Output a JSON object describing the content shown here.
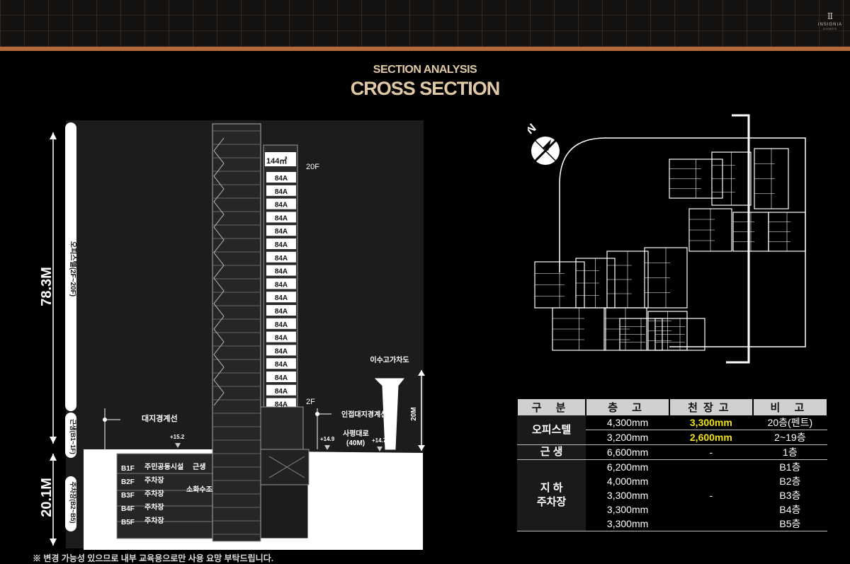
{
  "header": {
    "logo_mark": "Ⅱ",
    "logo_name": "INSIGNIA",
    "logo_sub": "HOMES"
  },
  "titles": {
    "section": "SECTION ANALYSIS",
    "subtitle": "CROSS SECTION"
  },
  "section_diagram": {
    "height_above": "78.3M",
    "height_below": "20.1M",
    "zone_officetel": "오피스텔(2F~20F)",
    "zone_retail": "근생(B1~1F)",
    "zone_parking": "주차장(B2~B5)",
    "top_unit": "144㎡",
    "unit_label": "84A",
    "unit_count": 18,
    "floor_top": "20F",
    "floor_bottom": "2F",
    "site_line": "대지경계선",
    "adjacent_line": "인접대지경계선",
    "road_name": "사평대로",
    "road_width": "(40M)",
    "overpass": "이수고가차도",
    "overpass_height": "20M",
    "level_1": "+15.2",
    "level_2": "+14.9",
    "level_3": "+14.7",
    "basement_floors": [
      {
        "floor": "B1F",
        "use": "주민공동시설",
        "extra": "근생"
      },
      {
        "floor": "B2F",
        "use": "주차장",
        "extra": ""
      },
      {
        "floor": "B3F",
        "use": "주차장",
        "extra": ""
      },
      {
        "floor": "B4F",
        "use": "주차장",
        "extra": ""
      },
      {
        "floor": "B5F",
        "use": "주차장",
        "extra": ""
      }
    ],
    "fire_tank": "소화수조"
  },
  "table": {
    "headers": [
      "구 분",
      "층 고",
      "천장고",
      "비 고"
    ],
    "officetel_label": "오피스텔",
    "officetel_rows": [
      {
        "height": "4,300mm",
        "ceiling": "3,300mm",
        "note": "20층(펜트)"
      },
      {
        "height": "3,200mm",
        "ceiling": "2,600mm",
        "note": "2~19층"
      }
    ],
    "retail_label": "근 생",
    "retail_row": {
      "height": "6,600mm",
      "ceiling": "-",
      "note": "1층"
    },
    "parking_label_1": "지 하",
    "parking_label_2": "주차장",
    "parking_heights": [
      "6,200mm",
      "4,000mm",
      "3,300mm",
      "3,300mm",
      "3,300mm"
    ],
    "parking_ceiling": "-",
    "parking_notes": [
      "B1층",
      "B2층",
      "B3층",
      "B4층",
      "B5층"
    ],
    "highlight_color": "#f2e21a"
  },
  "compass": {
    "label": "N"
  },
  "disclaimer": "※ 변경 가능성 있으므로 내부 교육용으로만 사용 요망 부탁드립니다."
}
